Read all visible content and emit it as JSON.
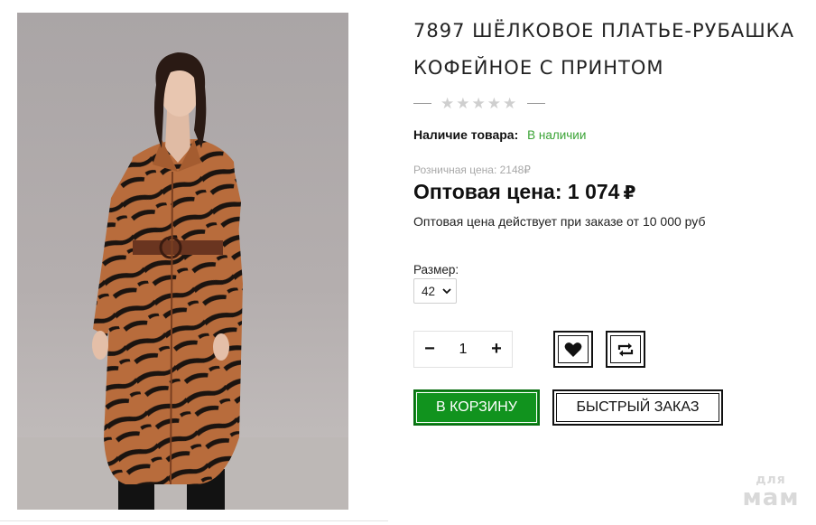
{
  "product": {
    "title_line1": "7897 ШЁЛКОВОЕ ПЛАТЬЕ-РУБАШКА",
    "title_line2": "КОФЕЙНОЕ С ПРИНТОМ"
  },
  "rating": {
    "stars": 0,
    "max": 5
  },
  "availability": {
    "label": "Наличие товара:",
    "value": "В наличии"
  },
  "price": {
    "retail": "Розничная цена: 2148₽",
    "wholesale_label": "Оптовая цена: 1 074",
    "currency": "₽",
    "note": "Оптовая цена действует при заказе от 10 000 руб"
  },
  "size": {
    "label": "Размер:",
    "selected": "42"
  },
  "quantity": {
    "minus": "−",
    "value": "1",
    "plus": "+"
  },
  "buttons": {
    "cart": "В КОРЗИНУ",
    "quick_order": "БЫСТРЫЙ ЗАКАЗ"
  },
  "watermark": {
    "top": "для",
    "main": "мам"
  },
  "colors": {
    "accent_green": "#11931e",
    "in_stock": "#3aa335"
  }
}
